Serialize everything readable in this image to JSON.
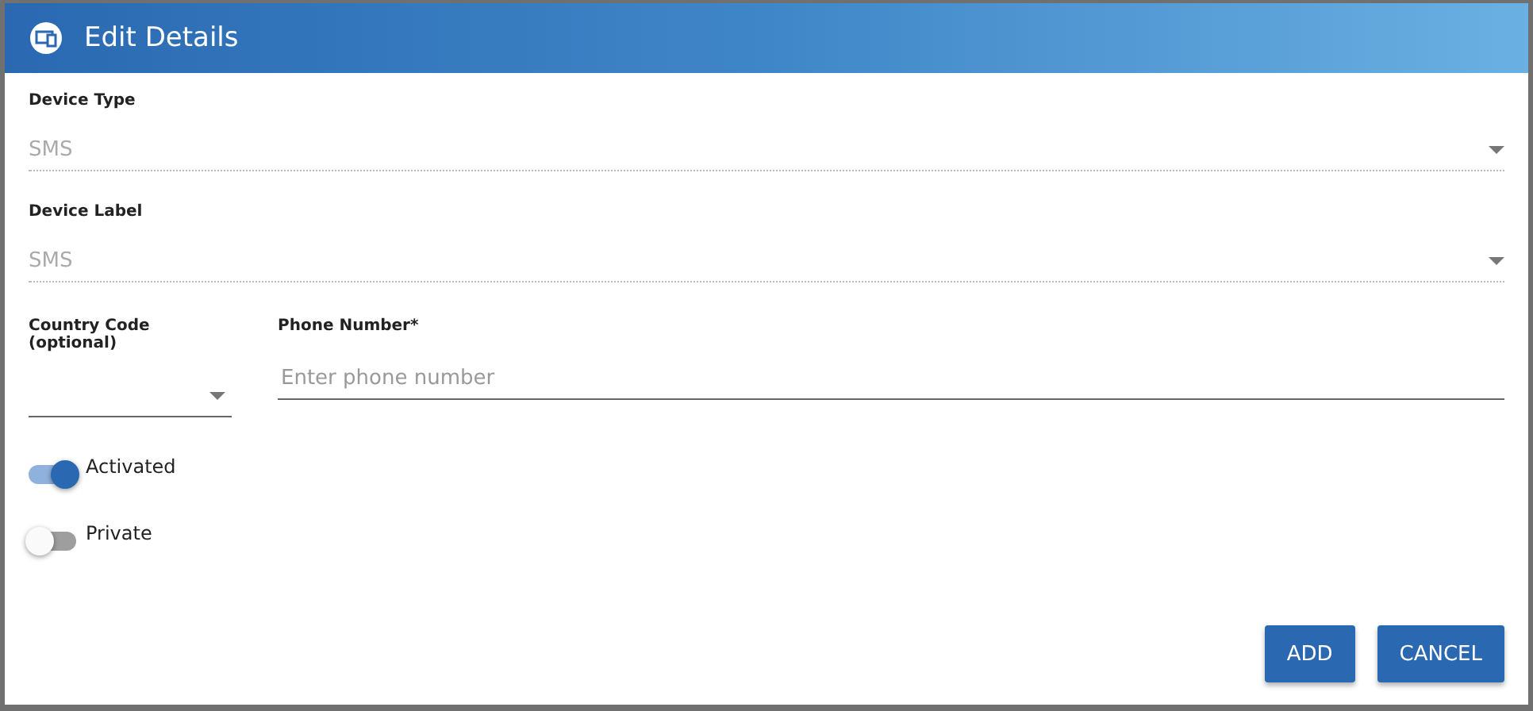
{
  "dialog": {
    "title": "Edit Details"
  },
  "selects": [
    {
      "label": "Device Type",
      "value": "SMS",
      "disabled": true
    },
    {
      "label": "Device Label",
      "value": "SMS",
      "disabled": true
    }
  ],
  "country_code": {
    "label": "Country Code (optional)"
  },
  "phone_number": {
    "label": "Phone Number*",
    "placeholder": "Enter phone number"
  },
  "toggles": [
    {
      "label": "Activated",
      "on": true
    },
    {
      "label": "Private",
      "on": false
    }
  ],
  "buttons": [
    "ADD",
    "CANCEL"
  ]
}
